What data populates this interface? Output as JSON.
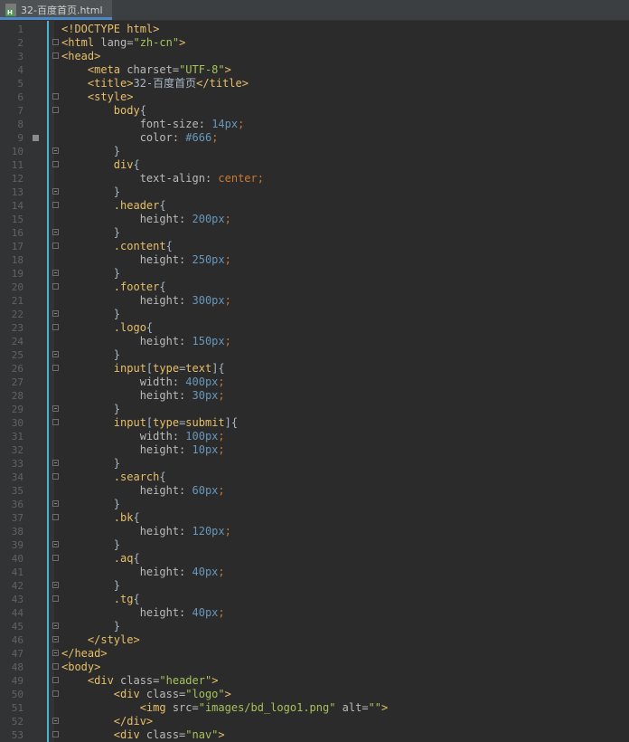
{
  "tab": {
    "title": "32-百度首页.html",
    "icon": "html-file-icon"
  },
  "colors": {
    "background": "#2b2b2b",
    "gutter": "#313335",
    "tag": "#e8bf6a",
    "string": "#a5c25c",
    "number": "#6897bb",
    "keyword": "#cc7832",
    "text": "#a9b7c6",
    "accent": "#4ab3d6"
  },
  "lines": [
    {
      "n": "1",
      "fold": "",
      "tokens": [
        [
          "doctype",
          "<!DOCTYPE html>"
        ]
      ]
    },
    {
      "n": "2",
      "fold": "start",
      "tokens": [
        [
          "tag",
          "<html "
        ],
        [
          "attr",
          "lang="
        ],
        [
          "str",
          "\"zh-cn\""
        ],
        [
          "tag",
          ">"
        ]
      ]
    },
    {
      "n": "3",
      "fold": "start",
      "tokens": [
        [
          "tag",
          "<head>"
        ]
      ]
    },
    {
      "n": "4",
      "fold": "",
      "tokens": [
        [
          "plain",
          "    "
        ],
        [
          "tag",
          "<meta "
        ],
        [
          "attr",
          "charset="
        ],
        [
          "str",
          "\"UTF-8\""
        ],
        [
          "tag",
          ">"
        ]
      ]
    },
    {
      "n": "5",
      "fold": "",
      "tokens": [
        [
          "plain",
          "    "
        ],
        [
          "tag",
          "<title>"
        ],
        [
          "txt",
          "32-百度首页"
        ],
        [
          "tag",
          "</title>"
        ]
      ]
    },
    {
      "n": "6",
      "fold": "start",
      "tokens": [
        [
          "plain",
          "    "
        ],
        [
          "tag",
          "<style>"
        ]
      ]
    },
    {
      "n": "7",
      "fold": "start",
      "tokens": [
        [
          "plain",
          "        "
        ],
        [
          "sel",
          "body"
        ],
        [
          "plain",
          "{"
        ]
      ]
    },
    {
      "n": "8",
      "fold": "",
      "tokens": [
        [
          "plain",
          "            "
        ],
        [
          "prop",
          "font-size: "
        ],
        [
          "num",
          "14px"
        ],
        [
          "punc",
          ";"
        ]
      ]
    },
    {
      "n": "9",
      "fold": "",
      "bookmark": true,
      "tokens": [
        [
          "plain",
          "            "
        ],
        [
          "prop",
          "color: "
        ],
        [
          "num",
          "#666"
        ],
        [
          "punc",
          ";"
        ]
      ]
    },
    {
      "n": "10",
      "fold": "end",
      "tokens": [
        [
          "plain",
          "        }"
        ]
      ]
    },
    {
      "n": "11",
      "fold": "start",
      "tokens": [
        [
          "plain",
          "        "
        ],
        [
          "sel",
          "div"
        ],
        [
          "plain",
          "{"
        ]
      ]
    },
    {
      "n": "12",
      "fold": "",
      "tokens": [
        [
          "plain",
          "            "
        ],
        [
          "prop",
          "text-align: "
        ],
        [
          "val",
          "center"
        ],
        [
          "punc",
          ";"
        ]
      ]
    },
    {
      "n": "13",
      "fold": "end",
      "tokens": [
        [
          "plain",
          "        }"
        ]
      ]
    },
    {
      "n": "14",
      "fold": "start",
      "tokens": [
        [
          "plain",
          "        "
        ],
        [
          "sel",
          ".header"
        ],
        [
          "plain",
          "{"
        ]
      ]
    },
    {
      "n": "15",
      "fold": "",
      "tokens": [
        [
          "plain",
          "            "
        ],
        [
          "prop",
          "height: "
        ],
        [
          "num",
          "200px"
        ],
        [
          "punc",
          ";"
        ]
      ]
    },
    {
      "n": "16",
      "fold": "end",
      "tokens": [
        [
          "plain",
          "        }"
        ]
      ]
    },
    {
      "n": "17",
      "fold": "start",
      "tokens": [
        [
          "plain",
          "        "
        ],
        [
          "sel",
          ".content"
        ],
        [
          "plain",
          "{"
        ]
      ]
    },
    {
      "n": "18",
      "fold": "",
      "tokens": [
        [
          "plain",
          "            "
        ],
        [
          "prop",
          "height: "
        ],
        [
          "num",
          "250px"
        ],
        [
          "punc",
          ";"
        ]
      ]
    },
    {
      "n": "19",
      "fold": "end",
      "tokens": [
        [
          "plain",
          "        }"
        ]
      ]
    },
    {
      "n": "20",
      "fold": "start",
      "tokens": [
        [
          "plain",
          "        "
        ],
        [
          "sel",
          ".footer"
        ],
        [
          "plain",
          "{"
        ]
      ]
    },
    {
      "n": "21",
      "fold": "",
      "tokens": [
        [
          "plain",
          "            "
        ],
        [
          "prop",
          "height: "
        ],
        [
          "num",
          "300px"
        ],
        [
          "punc",
          ";"
        ]
      ]
    },
    {
      "n": "22",
      "fold": "end",
      "tokens": [
        [
          "plain",
          "        }"
        ]
      ]
    },
    {
      "n": "23",
      "fold": "start",
      "tokens": [
        [
          "plain",
          "        "
        ],
        [
          "sel",
          ".logo"
        ],
        [
          "plain",
          "{"
        ]
      ]
    },
    {
      "n": "24",
      "fold": "",
      "tokens": [
        [
          "plain",
          "            "
        ],
        [
          "prop",
          "height: "
        ],
        [
          "num",
          "150px"
        ],
        [
          "punc",
          ";"
        ]
      ]
    },
    {
      "n": "25",
      "fold": "end",
      "tokens": [
        [
          "plain",
          "        }"
        ]
      ]
    },
    {
      "n": "26",
      "fold": "start",
      "tokens": [
        [
          "plain",
          "        "
        ],
        [
          "sel",
          "input"
        ],
        [
          "plain",
          "["
        ],
        [
          "sel",
          "type"
        ],
        [
          "plain",
          "="
        ],
        [
          "sel",
          "text"
        ],
        [
          "plain",
          "]{"
        ]
      ]
    },
    {
      "n": "27",
      "fold": "",
      "tokens": [
        [
          "plain",
          "            "
        ],
        [
          "prop",
          "width: "
        ],
        [
          "num",
          "400px"
        ],
        [
          "punc",
          ";"
        ]
      ]
    },
    {
      "n": "28",
      "fold": "",
      "tokens": [
        [
          "plain",
          "            "
        ],
        [
          "prop",
          "height: "
        ],
        [
          "num",
          "30px"
        ],
        [
          "punc",
          ";"
        ]
      ]
    },
    {
      "n": "29",
      "fold": "end",
      "tokens": [
        [
          "plain",
          "        }"
        ]
      ]
    },
    {
      "n": "30",
      "fold": "start",
      "tokens": [
        [
          "plain",
          "        "
        ],
        [
          "sel",
          "input"
        ],
        [
          "plain",
          "["
        ],
        [
          "sel",
          "type"
        ],
        [
          "plain",
          "="
        ],
        [
          "sel",
          "submit"
        ],
        [
          "plain",
          "]{"
        ]
      ]
    },
    {
      "n": "31",
      "fold": "",
      "tokens": [
        [
          "plain",
          "            "
        ],
        [
          "prop",
          "width: "
        ],
        [
          "num",
          "100px"
        ],
        [
          "punc",
          ";"
        ]
      ]
    },
    {
      "n": "32",
      "fold": "",
      "tokens": [
        [
          "plain",
          "            "
        ],
        [
          "prop",
          "height: "
        ],
        [
          "num",
          "10px"
        ],
        [
          "punc",
          ";"
        ]
      ]
    },
    {
      "n": "33",
      "fold": "end",
      "tokens": [
        [
          "plain",
          "        }"
        ]
      ]
    },
    {
      "n": "34",
      "fold": "start",
      "tokens": [
        [
          "plain",
          "        "
        ],
        [
          "sel",
          ".search"
        ],
        [
          "plain",
          "{"
        ]
      ]
    },
    {
      "n": "35",
      "fold": "",
      "tokens": [
        [
          "plain",
          "            "
        ],
        [
          "prop",
          "height: "
        ],
        [
          "num",
          "60px"
        ],
        [
          "punc",
          ";"
        ]
      ]
    },
    {
      "n": "36",
      "fold": "end",
      "tokens": [
        [
          "plain",
          "        }"
        ]
      ]
    },
    {
      "n": "37",
      "fold": "start",
      "tokens": [
        [
          "plain",
          "        "
        ],
        [
          "sel",
          ".bk"
        ],
        [
          "plain",
          "{"
        ]
      ]
    },
    {
      "n": "38",
      "fold": "",
      "tokens": [
        [
          "plain",
          "            "
        ],
        [
          "prop",
          "height: "
        ],
        [
          "num",
          "120px"
        ],
        [
          "punc",
          ";"
        ]
      ]
    },
    {
      "n": "39",
      "fold": "end",
      "tokens": [
        [
          "plain",
          "        }"
        ]
      ]
    },
    {
      "n": "40",
      "fold": "start",
      "tokens": [
        [
          "plain",
          "        "
        ],
        [
          "sel",
          ".aq"
        ],
        [
          "plain",
          "{"
        ]
      ]
    },
    {
      "n": "41",
      "fold": "",
      "tokens": [
        [
          "plain",
          "            "
        ],
        [
          "prop",
          "height: "
        ],
        [
          "num",
          "40px"
        ],
        [
          "punc",
          ";"
        ]
      ]
    },
    {
      "n": "42",
      "fold": "end",
      "tokens": [
        [
          "plain",
          "        }"
        ]
      ]
    },
    {
      "n": "43",
      "fold": "start",
      "tokens": [
        [
          "plain",
          "        "
        ],
        [
          "sel",
          ".tg"
        ],
        [
          "plain",
          "{"
        ]
      ]
    },
    {
      "n": "44",
      "fold": "",
      "tokens": [
        [
          "plain",
          "            "
        ],
        [
          "prop",
          "height: "
        ],
        [
          "num",
          "40px"
        ],
        [
          "punc",
          ";"
        ]
      ]
    },
    {
      "n": "45",
      "fold": "end",
      "tokens": [
        [
          "plain",
          "        }"
        ]
      ]
    },
    {
      "n": "46",
      "fold": "end",
      "tokens": [
        [
          "plain",
          "    "
        ],
        [
          "tag",
          "</style>"
        ]
      ]
    },
    {
      "n": "47",
      "fold": "end",
      "tokens": [
        [
          "tag",
          "</head>"
        ]
      ]
    },
    {
      "n": "48",
      "fold": "start",
      "tokens": [
        [
          "tag",
          "<body>"
        ]
      ]
    },
    {
      "n": "49",
      "fold": "start",
      "tokens": [
        [
          "plain",
          "    "
        ],
        [
          "tag",
          "<div "
        ],
        [
          "attr",
          "class="
        ],
        [
          "str",
          "\"header\""
        ],
        [
          "tag",
          ">"
        ]
      ]
    },
    {
      "n": "50",
      "fold": "start",
      "tokens": [
        [
          "plain",
          "        "
        ],
        [
          "tag",
          "<div "
        ],
        [
          "attr",
          "class="
        ],
        [
          "str",
          "\"logo\""
        ],
        [
          "tag",
          ">"
        ]
      ]
    },
    {
      "n": "51",
      "fold": "",
      "tokens": [
        [
          "plain",
          "            "
        ],
        [
          "tag",
          "<img "
        ],
        [
          "attr",
          "src="
        ],
        [
          "str",
          "\"images/bd_logo1.png\""
        ],
        [
          "attr",
          " alt="
        ],
        [
          "str",
          "\"\""
        ],
        [
          "tag",
          ">"
        ]
      ]
    },
    {
      "n": "52",
      "fold": "end",
      "tokens": [
        [
          "plain",
          "        "
        ],
        [
          "tag",
          "</div>"
        ]
      ]
    },
    {
      "n": "53",
      "fold": "start",
      "tokens": [
        [
          "plain",
          "        "
        ],
        [
          "tag",
          "<div "
        ],
        [
          "attr",
          "class="
        ],
        [
          "str",
          "\"nav\""
        ],
        [
          "tag",
          ">"
        ]
      ]
    }
  ]
}
